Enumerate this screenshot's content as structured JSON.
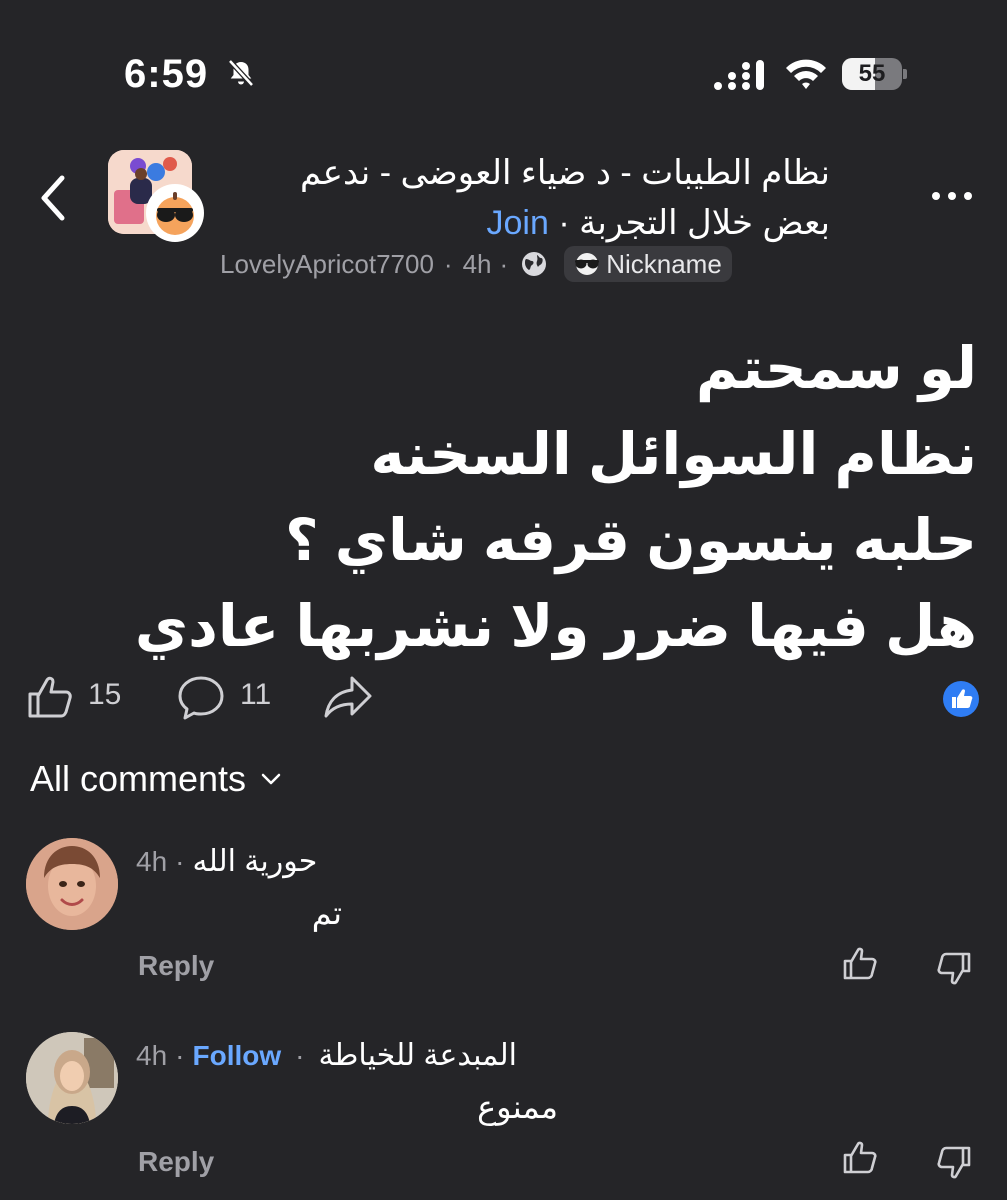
{
  "status_bar": {
    "time": "6:59",
    "battery": "55"
  },
  "header": {
    "group_title_line1": "نظام الطيبات - د ضياء العوضى - ندعم",
    "group_title_line2": "بعض خلال التجربة",
    "join_label": "Join",
    "dot": "·",
    "author": "LovelyApricot7700",
    "time": "4h",
    "nickname_label": "Nickname"
  },
  "post": {
    "lines": [
      "لو سمحتم",
      "نظام السوائل السخنه",
      "حلبه ينسون قرفه شاي ؟",
      "هل فيها ضرر ولا نشربها عادي"
    ],
    "like_count": "15",
    "comment_count": "11"
  },
  "comments_header": {
    "label": "All comments"
  },
  "comments": [
    {
      "name": "حورية الله",
      "time": "4h",
      "text": "تم",
      "reply_label": "Reply"
    },
    {
      "name": "المبدعة للخياطة",
      "time": "4h",
      "follow_label": "Follow",
      "text": "ممنوع",
      "reply_label": "Reply"
    }
  ],
  "colors": {
    "background": "#252528",
    "accent": "#6aa8ff",
    "muted": "#a0a0a6"
  },
  "icons": {
    "back": "chevron-left-icon",
    "more": "more-horizontal-icon",
    "like": "thumbs-up-icon",
    "comment": "comment-bubble-icon",
    "share": "share-arrow-icon",
    "dislike": "thumbs-down-icon",
    "globe": "globe-icon",
    "muted_bell": "bell-slash-icon"
  }
}
